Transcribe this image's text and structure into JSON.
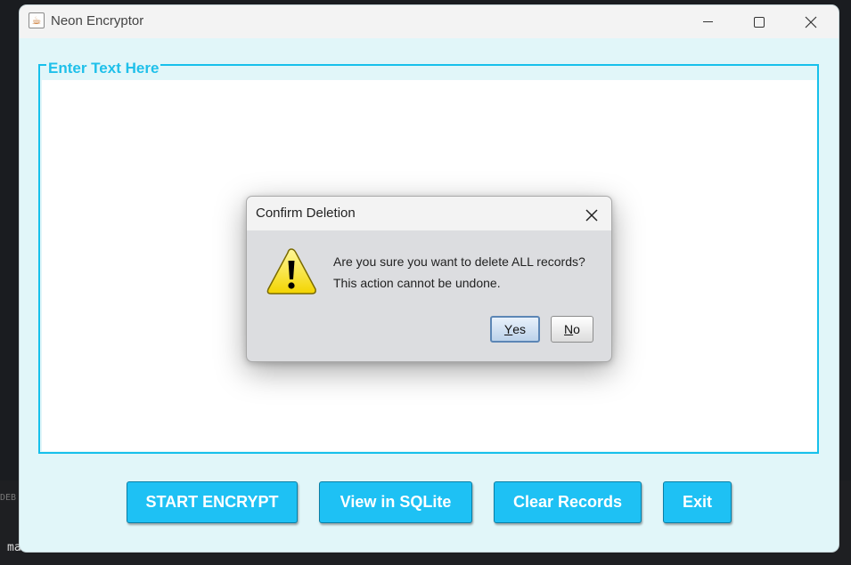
{
  "background_terminal": {
    "side_label": "DEB",
    "line1": "ma",
    "line2": "main"
  },
  "window": {
    "title": "Neon Encryptor",
    "app_icon": "java-coffee-icon",
    "controls": {
      "minimize_icon": "minimize-icon",
      "maximize_icon": "maximize-icon",
      "close_icon": "close-icon"
    }
  },
  "text_group": {
    "title": "Enter Text Here",
    "text_value": "",
    "border_color": "#16c0eb"
  },
  "buttons": {
    "encrypt": "START ENCRYPT",
    "sqlite": "View in SQLite",
    "clear": "Clear Records",
    "exit": "Exit"
  },
  "dialog": {
    "title": "Confirm Deletion",
    "close_icon": "close-icon",
    "icon": "warning-icon",
    "message_line1": "Are you sure you want to delete ALL records?",
    "message_line2": "This action cannot be undone.",
    "yes_mnemonic": "Y",
    "yes_rest": "es",
    "no_mnemonic": "N",
    "no_rest": "o"
  },
  "colors": {
    "accent": "#1ec1f4",
    "window_bg": "#e1f6f9",
    "dialog_bg": "#dcdde0"
  }
}
